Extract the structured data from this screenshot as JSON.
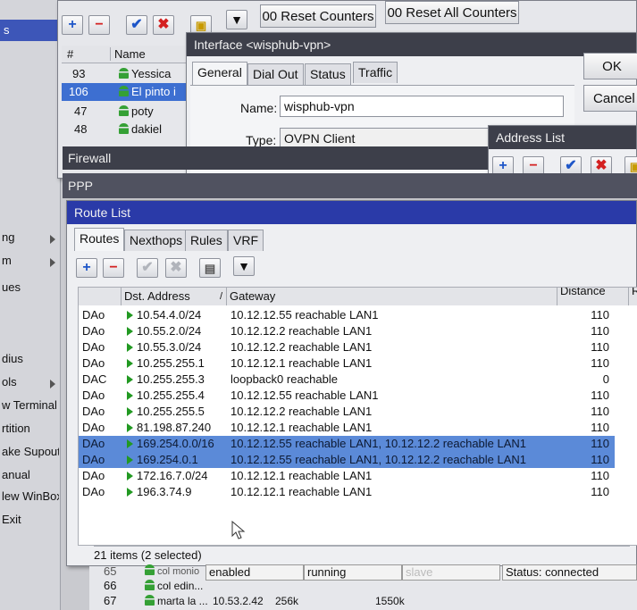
{
  "toolbar_top": {
    "reset_counters_label": "00 Reset Counters",
    "reset_all_counters_label": "00 Reset All Counters"
  },
  "ppp_list": {
    "header_num": "#",
    "header_name": "Name",
    "rows": [
      {
        "num": "93",
        "name": "Yessica"
      },
      {
        "num": "106",
        "name": "El pinto i"
      },
      {
        "num": "47",
        "name": "poty"
      },
      {
        "num": "48",
        "name": "dakiel"
      }
    ]
  },
  "sidebar": {
    "items": [
      {
        "label": "ng",
        "arrow": true
      },
      {
        "label": "m",
        "arrow": true
      },
      {
        "label": "ues",
        "arrow": false
      },
      {
        "label": "dius",
        "arrow": false
      },
      {
        "label": "ols",
        "arrow": true
      },
      {
        "label": "w Terminal",
        "arrow": false
      },
      {
        "label": "rtition",
        "arrow": false
      },
      {
        "label": "ake Supout.rif",
        "arrow": false
      },
      {
        "label": "anual",
        "arrow": false
      },
      {
        "label": "lew WinBox",
        "arrow": false
      },
      {
        "label": "Exit",
        "arrow": false
      }
    ],
    "top_label": "s"
  },
  "interface_window": {
    "title": "Interface <wisphub-vpn>",
    "tabs": [
      "General",
      "Dial Out",
      "Status",
      "Traffic"
    ],
    "name_label": "Name:",
    "name_value": "wisphub-vpn",
    "type_label": "Type:",
    "type_value": "OVPN Client",
    "ok_label": "OK",
    "cancel_label": "Cancel"
  },
  "address_list_window": {
    "title": "Address List"
  },
  "firewall_window": {
    "title": "Firewall"
  },
  "ppp_window": {
    "title": "PPP"
  },
  "route_window": {
    "title": "Route List",
    "tabs": [
      "Routes",
      "Nexthops",
      "Rules",
      "VRF"
    ],
    "columns": [
      "",
      "Dst. Address",
      "Gateway",
      "Distance",
      "R"
    ],
    "rows": [
      {
        "flags": "DAo",
        "dst": "10.54.4.0/24",
        "gateway": "10.12.12.55 reachable LAN1",
        "distance": "110",
        "selected": false
      },
      {
        "flags": "DAo",
        "dst": "10.55.2.0/24",
        "gateway": "10.12.12.2 reachable LAN1",
        "distance": "110",
        "selected": false
      },
      {
        "flags": "DAo",
        "dst": "10.55.3.0/24",
        "gateway": "10.12.12.2 reachable LAN1",
        "distance": "110",
        "selected": false
      },
      {
        "flags": "DAo",
        "dst": "10.255.255.1",
        "gateway": "10.12.12.1 reachable LAN1",
        "distance": "110",
        "selected": false
      },
      {
        "flags": "DAC",
        "dst": "10.255.255.3",
        "gateway": "loopback0 reachable",
        "distance": "0",
        "selected": false
      },
      {
        "flags": "DAo",
        "dst": "10.255.255.4",
        "gateway": "10.12.12.55 reachable LAN1",
        "distance": "110",
        "selected": false
      },
      {
        "flags": "DAo",
        "dst": "10.255.255.5",
        "gateway": "10.12.12.2 reachable LAN1",
        "distance": "110",
        "selected": false
      },
      {
        "flags": "DAo",
        "dst": "81.198.87.240",
        "gateway": "10.12.12.1 reachable LAN1",
        "distance": "110",
        "selected": false
      },
      {
        "flags": "DAo",
        "dst": "169.254.0.0/16",
        "gateway": "10.12.12.55 reachable LAN1, 10.12.12.2 reachable LAN1",
        "distance": "110",
        "selected": true
      },
      {
        "flags": "DAo",
        "dst": "169.254.0.1",
        "gateway": "10.12.12.55 reachable LAN1, 10.12.12.2 reachable LAN1",
        "distance": "110",
        "selected": true
      },
      {
        "flags": "DAo",
        "dst": "172.16.7.0/24",
        "gateway": "10.12.12.1 reachable LAN1",
        "distance": "110",
        "selected": false
      },
      {
        "flags": "DAo",
        "dst": "196.3.74.9",
        "gateway": "10.12.12.1 reachable LAN1",
        "distance": "110",
        "selected": false
      }
    ],
    "status": "21 items (2 selected)"
  },
  "bottom_list": {
    "rows": [
      {
        "num": "65",
        "name": "col monio"
      },
      {
        "num": "66",
        "name": "col edin..."
      },
      {
        "num": "67",
        "name": "marta la ...",
        "address": "10.53.2.42",
        "rate": "256k",
        "bytes": "1550k"
      }
    ],
    "status_enabled": "enabled",
    "status_running": "running",
    "status_slave": "slave",
    "status_connected": "Status: connected"
  },
  "colors": {
    "titlebar": "#3d3f4a",
    "selection": "#5b8ad8",
    "route_titlebar": "#2a3aa8",
    "add_icon": "#1e56c8",
    "remove_icon": "#d42020"
  }
}
